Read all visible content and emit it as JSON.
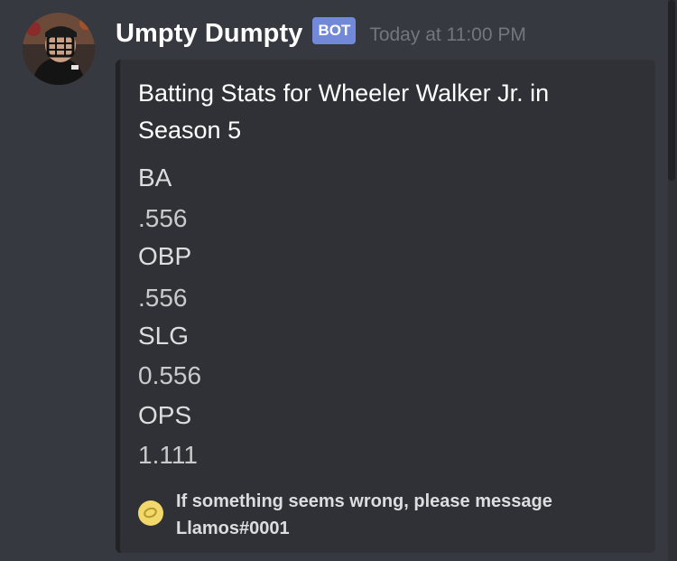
{
  "message": {
    "author": "Umpty Dumpty",
    "badge": "BOT",
    "timestamp": "Today at 11:00 PM",
    "avatar_icon": "umpire-avatar"
  },
  "embed": {
    "title": "Batting Stats for Wheeler Walker Jr. in Season 5",
    "fields": [
      {
        "name": "BA",
        "value": ".556"
      },
      {
        "name": "OBP",
        "value": ".556"
      },
      {
        "name": "SLG",
        "value": "0.556"
      },
      {
        "name": "OPS",
        "value": "1.111"
      }
    ],
    "footer": {
      "text": "If something seems wrong, please message Llamos#0001",
      "icon": "lemon-icon"
    }
  },
  "colors": {
    "background": "#36393f",
    "embed_background": "#2f3136",
    "embed_border": "#202225",
    "badge": "#7289da",
    "timestamp": "#72767d"
  }
}
